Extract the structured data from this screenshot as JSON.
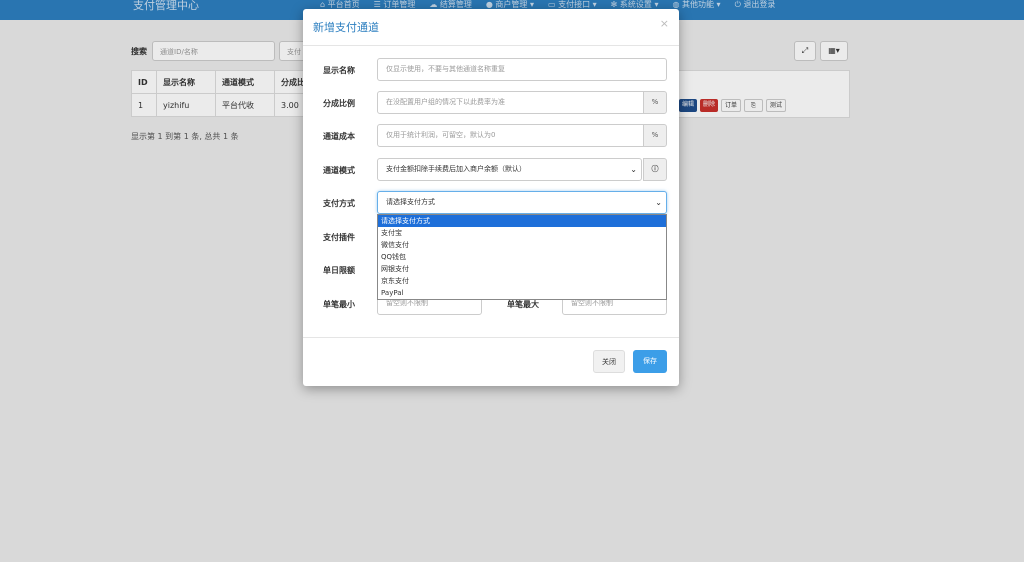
{
  "app": {
    "title": "支付管理中心"
  },
  "nav": [
    {
      "label": "平台首页",
      "icon": "home-icon"
    },
    {
      "label": "订单管理",
      "icon": "list-icon"
    },
    {
      "label": "结算管理",
      "icon": "cloud-icon"
    },
    {
      "label": "商户管理 ▾",
      "icon": "user-icon"
    },
    {
      "label": "支付接口 ▾",
      "icon": "card-icon"
    },
    {
      "label": "系统设置 ▾",
      "icon": "gear-icon"
    },
    {
      "label": "其他功能 ▾",
      "icon": "globe-icon"
    },
    {
      "label": "退出登录",
      "icon": "power-icon"
    }
  ],
  "search": {
    "label": "搜索",
    "placeholder": "通道ID/名称",
    "placeholder2": "支付"
  },
  "table": {
    "headers": [
      "ID",
      "显示名称",
      "通道模式",
      "分成比"
    ],
    "rows": [
      {
        "id": "1",
        "name": "yizhifu",
        "mode": "平台代收",
        "rate": "3.00"
      }
    ],
    "actions": {
      "edit": "编辑",
      "delete": "删除",
      "order": "订单",
      "copy": "⎘",
      "test": "测试"
    }
  },
  "footer": "显示第 1 到第 1 条, 总共 1 条",
  "modal": {
    "title": "新增支付通道",
    "close": "×",
    "fields": {
      "name_label": "显示名称",
      "name_placeholder": "仅显示使用，不要与其他通道名称重复",
      "rate_label": "分成比例",
      "rate_placeholder": "在没配置用户组的情况下以此费率为准",
      "rate_addon": "%",
      "cost_label": "通道成本",
      "cost_placeholder": "仅用于统计利润，可留空，默认为0",
      "cost_addon": "%",
      "mode_label": "通道模式",
      "mode_value": "支付金额扣除手续费后加入商户余额（默认）",
      "paytype_label": "支付方式",
      "paytype_value": "请选择支付方式",
      "plugin_label": "支付插件",
      "daylimit_label": "单日限额",
      "min_label": "单笔最小",
      "min_placeholder": "留空则不限制",
      "max_label": "单笔最大",
      "max_placeholder": "留空则不限制"
    },
    "dropdown_options": [
      "请选择支付方式",
      "支付宝",
      "微信支付",
      "QQ钱包",
      "网银支付",
      "京东支付",
      "PayPal"
    ],
    "buttons": {
      "close": "关闭",
      "save": "保存"
    }
  },
  "colors": {
    "accent": "#2d7fc0",
    "save": "#3c9ee8",
    "edit": "#1f4e8c",
    "delete": "#c9302c"
  }
}
